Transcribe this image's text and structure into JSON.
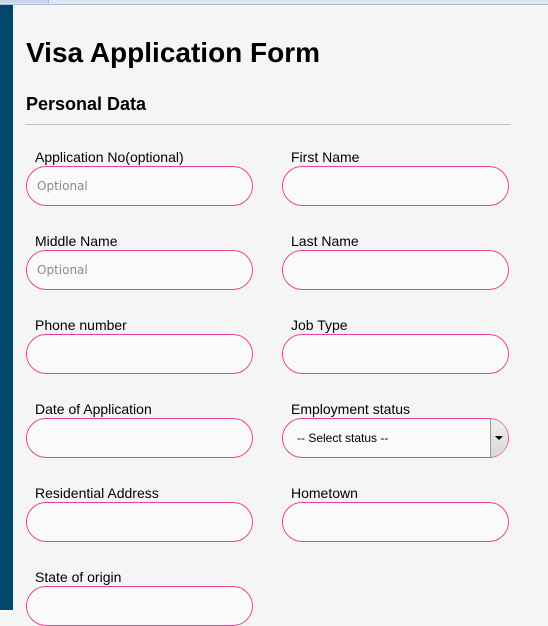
{
  "page": {
    "title": "Visa Application Form",
    "section": "Personal Data"
  },
  "fields": [
    {
      "label": "Application No(optional)",
      "placeholder": "Optional",
      "value": ""
    },
    {
      "label": "First Name",
      "placeholder": "",
      "value": ""
    },
    {
      "label": "Middle Name",
      "placeholder": "Optional",
      "value": ""
    },
    {
      "label": "Last Name",
      "placeholder": "",
      "value": ""
    },
    {
      "label": "Phone number",
      "placeholder": "",
      "value": ""
    },
    {
      "label": "Job Type",
      "placeholder": "",
      "value": ""
    },
    {
      "label": "Date of Application",
      "placeholder": "",
      "value": ""
    },
    {
      "label": "Employment status",
      "selected": "-- Select status --"
    },
    {
      "label": "Residential Address",
      "placeholder": "",
      "value": ""
    },
    {
      "label": "Hometown",
      "placeholder": "",
      "value": ""
    },
    {
      "label": "State of origin",
      "placeholder": "",
      "value": ""
    }
  ],
  "colors": {
    "sidebar": "#02486a",
    "input_border": "#e84393",
    "background": "#f5f5f5"
  }
}
